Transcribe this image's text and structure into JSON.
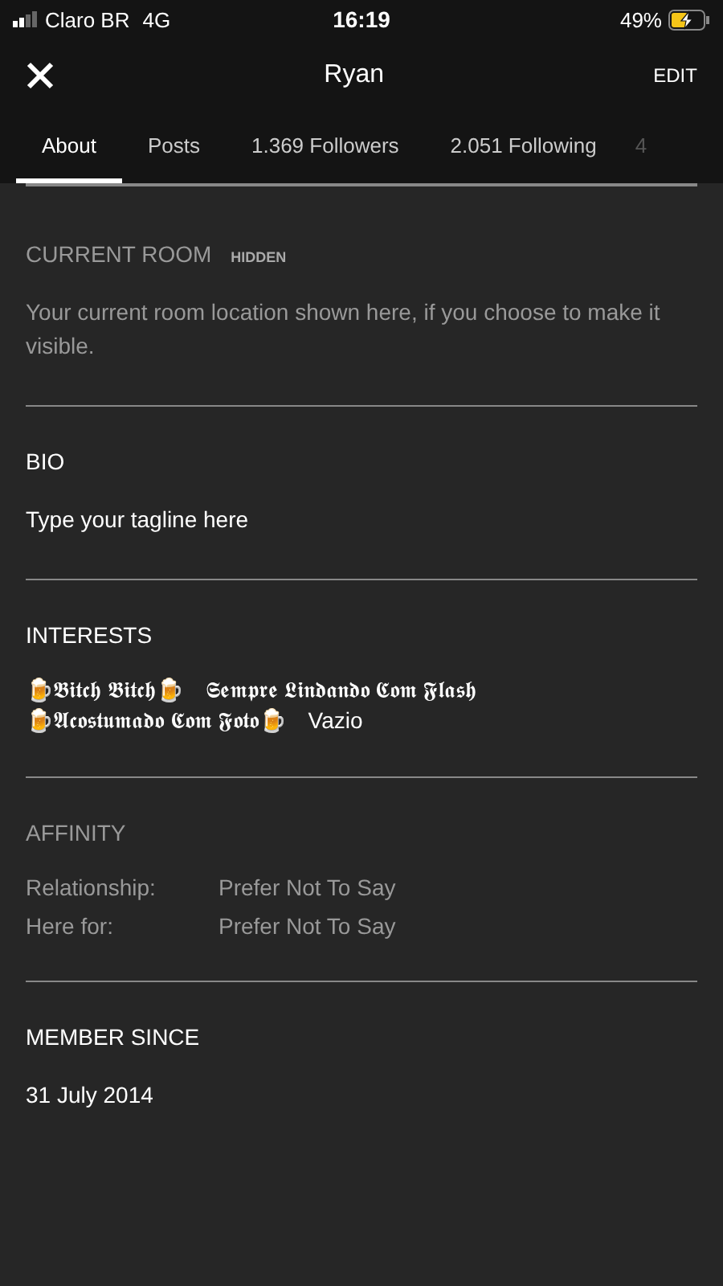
{
  "status_bar": {
    "carrier": "Claro BR",
    "network": "4G",
    "time": "16:19",
    "battery": "49%",
    "charging": true
  },
  "header": {
    "title": "Ryan",
    "action": "EDIT"
  },
  "tabs": [
    {
      "label": "About",
      "selected": true
    },
    {
      "label": "Posts",
      "selected": false
    },
    {
      "label": "1.369 Followers",
      "selected": false
    },
    {
      "label": "2.051 Following",
      "selected": false
    },
    {
      "label": "4",
      "selected": false
    }
  ],
  "sections": [
    {
      "kind": "text",
      "title": "CURRENT ROOM",
      "badge": "HIDDEN",
      "dimmed": true,
      "text": "Your current room location shown here, if you choose to make it visible."
    },
    {
      "kind": "text",
      "title": "BIO",
      "dimmed": false,
      "text": "Type your tagline here"
    },
    {
      "kind": "interests",
      "title": "INTERESTS",
      "dimmed": false,
      "items": [
        "🍺𝕭𝖎𝖙𝖈𝖍 𝕭𝖎𝖙𝖈𝖍🍺",
        "𝕾𝖊𝖒𝖕𝖗𝖊 𝕷𝖎𝖓𝖉𝖆𝖓𝖉𝖔 𝕮𝖔𝖒 𝕱𝖑𝖆𝖘𝖍",
        "🍺𝕬𝖈𝖔𝖘𝖙𝖚𝖒𝖆𝖉𝖔 𝕮𝖔𝖒 𝕱𝖔𝖙𝖔🍺",
        "Vazio"
      ]
    },
    {
      "kind": "fields",
      "title": "AFFINITY",
      "dimmed": true,
      "rows": [
        {
          "label": "Relationship:",
          "value": "Prefer Not To Say"
        },
        {
          "label": "Here for:",
          "value": "Prefer Not To Say"
        }
      ]
    },
    {
      "kind": "text",
      "title": "MEMBER SINCE",
      "dimmed": false,
      "text": "31 July 2014"
    }
  ]
}
